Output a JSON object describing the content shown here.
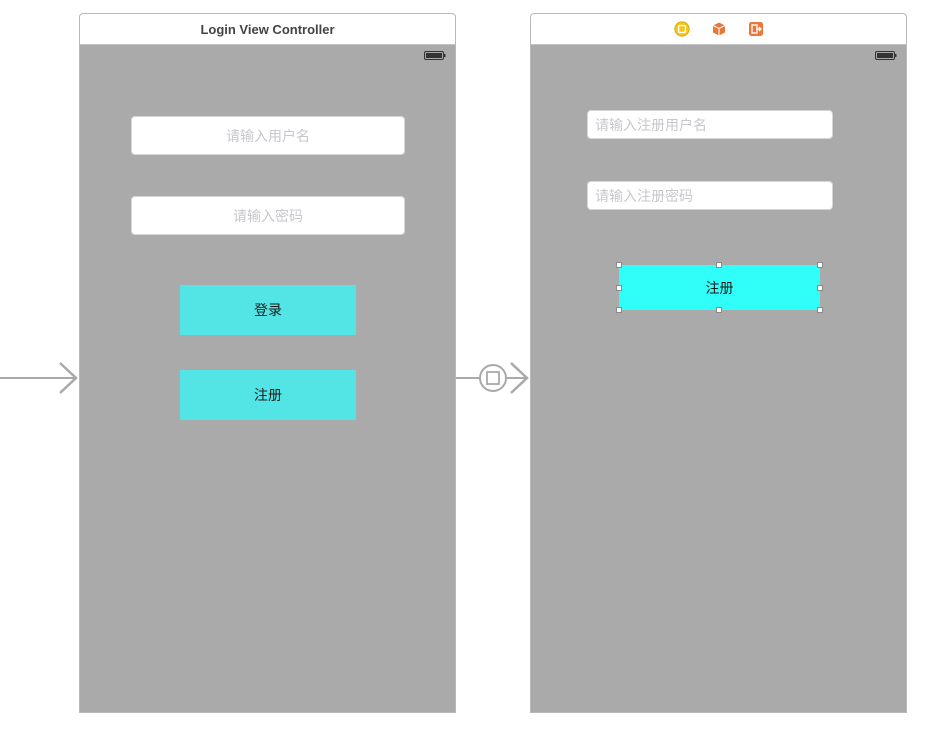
{
  "login_scene": {
    "title": "Login View Controller",
    "username_field": {
      "placeholder": "请输入用户名"
    },
    "password_field": {
      "placeholder": "请输入密码"
    },
    "login_button": {
      "label": "登录"
    },
    "register_button": {
      "label": "注册"
    }
  },
  "register_scene": {
    "dock_icons": [
      "view-controller-icon",
      "first-responder-icon",
      "exit-icon"
    ],
    "username_field": {
      "placeholder": "请输入注册用户名"
    },
    "password_field": {
      "placeholder": "请输入注册密码"
    },
    "register_button": {
      "label": "注册"
    }
  },
  "colors": {
    "canvas_background": "#ffffff",
    "scene_background": "#aaaaaa",
    "login_scene_button": "#53e5e5",
    "register_scene_button": "#2ffff8",
    "placeholder_text": "#c7c7cd",
    "segue_arrow": "#a9a9a9",
    "view_controller_icon": "#f5c518",
    "first_responder_icon": "#e8773a",
    "exit_icon": "#e8773a"
  }
}
